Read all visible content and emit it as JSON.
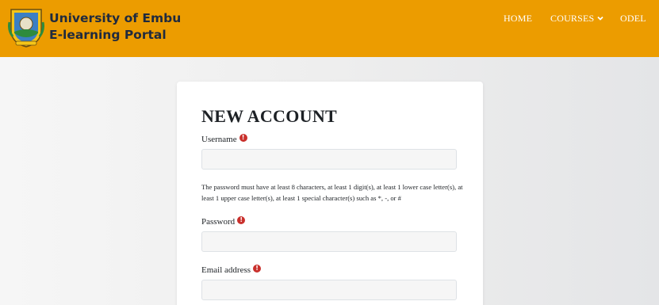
{
  "header": {
    "brand_line1": "University of Embu",
    "brand_line2": "E-learning Portal",
    "nav": {
      "home": "HOME",
      "courses": "COURSES",
      "odel": "ODEL"
    },
    "bg_color": "#ec9c00"
  },
  "form": {
    "title": "NEW ACCOUNT",
    "username_label": "Username",
    "username_value": "",
    "password_hint": "The password must have at least 8 characters, at least 1 digit(s), at least 1 lower case letter(s), at least 1 upper case letter(s), at least 1 special character(s) such as *, -, or #",
    "password_label": "Password",
    "password_value": "",
    "email_label": "Email address",
    "email_value": "",
    "required_icon": "exclamation-circle-icon",
    "required_color": "#c9302c"
  }
}
